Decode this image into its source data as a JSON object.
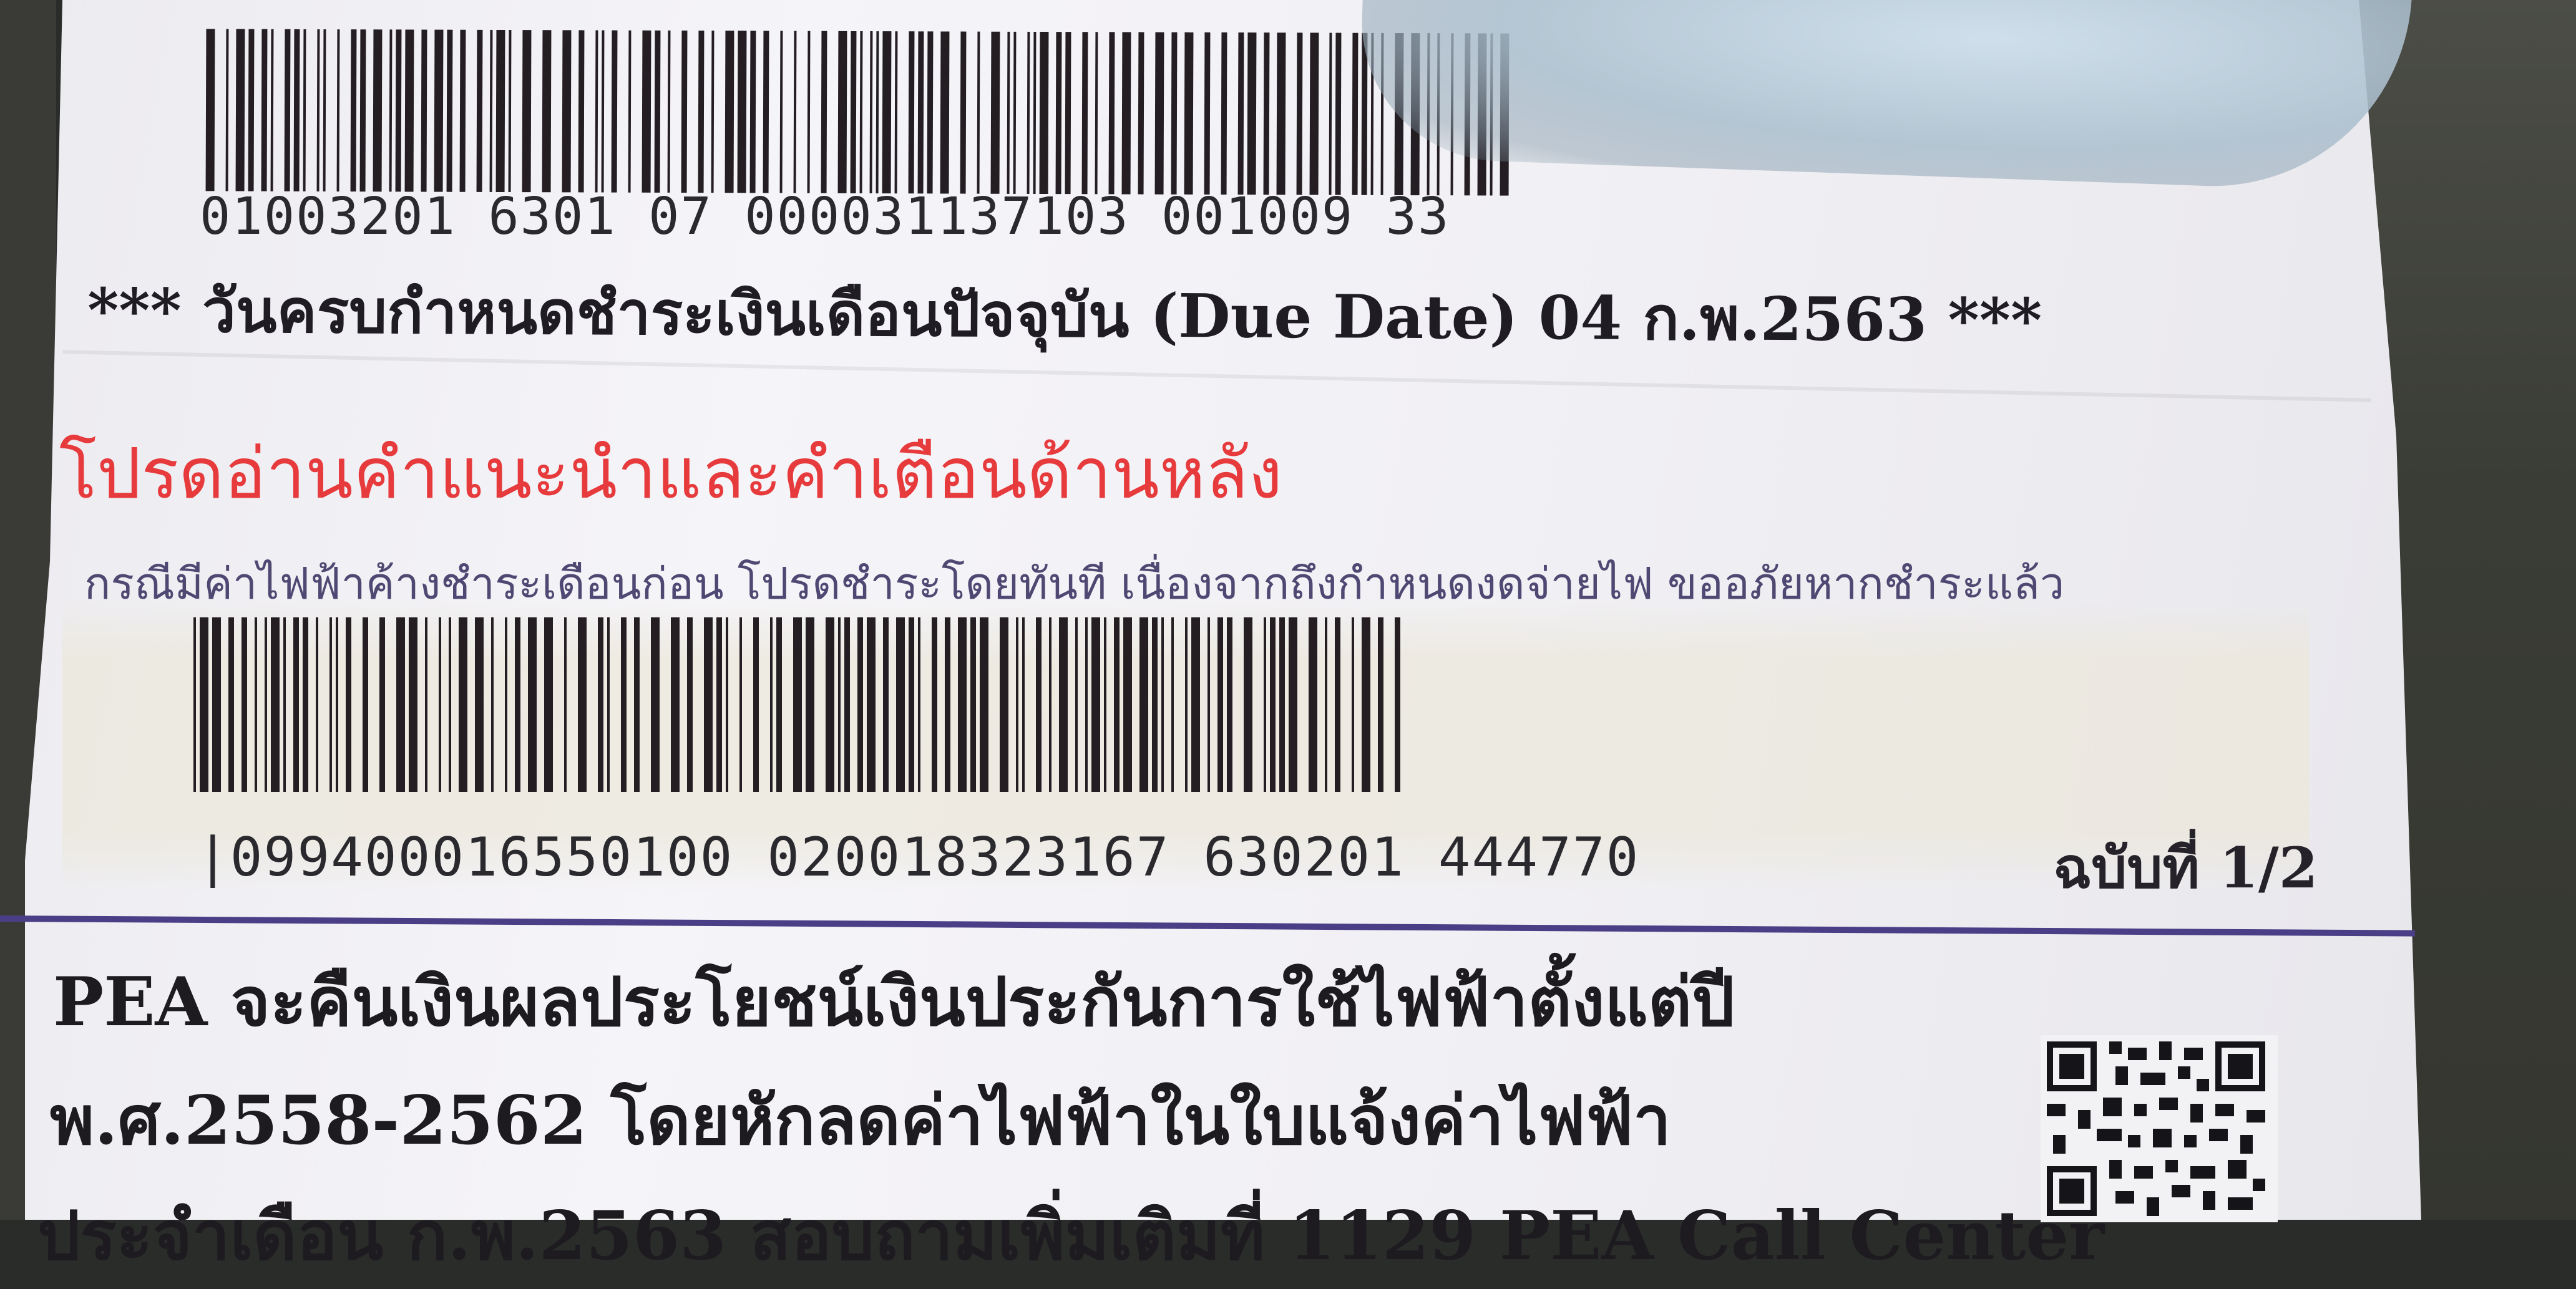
{
  "receipt": {
    "barcode_top_number": "01003201 6301 07 000031137103 001009 33",
    "due_date_line": "*** วันครบกำหนดชำระเงินเดือนปัจจุบัน (Due Date) 04 ก.พ.2563 ***",
    "warning": "โปรดอ่านคำแนะนำและคำเตือนด้านหลัง",
    "notice": "กรณีมีค่าไฟฟ้าค้างชำระเดือนก่อน โปรดชำระโดยทันที เนื่องจากถึงกำหนดงดจ่ายไฟ ขออภัยหากชำระแล้ว",
    "barcode_bottom_number": "|099400016550100 020018323167 630201 444770",
    "copy_label": "ฉบับที่ 1/2",
    "promo_line1": "PEA จะคืนเงินผลประโยชน์เงินประกันการใช้ไฟฟ้าตั้งแต่ปี",
    "promo_line2": "พ.ศ.2558-2562 โดยหักลดค่าไฟฟ้าในใบแจ้งค่าไฟฟ้า",
    "promo_line3": "ประจำเดือน ก.พ.2563 สอบถามเพิ่มเติมที่ 1129 PEA Call Center"
  },
  "colors": {
    "warning": "#e63a3c",
    "notice": "#4e4872",
    "rule": "#4a3f86",
    "ink": "#1f1c24"
  }
}
